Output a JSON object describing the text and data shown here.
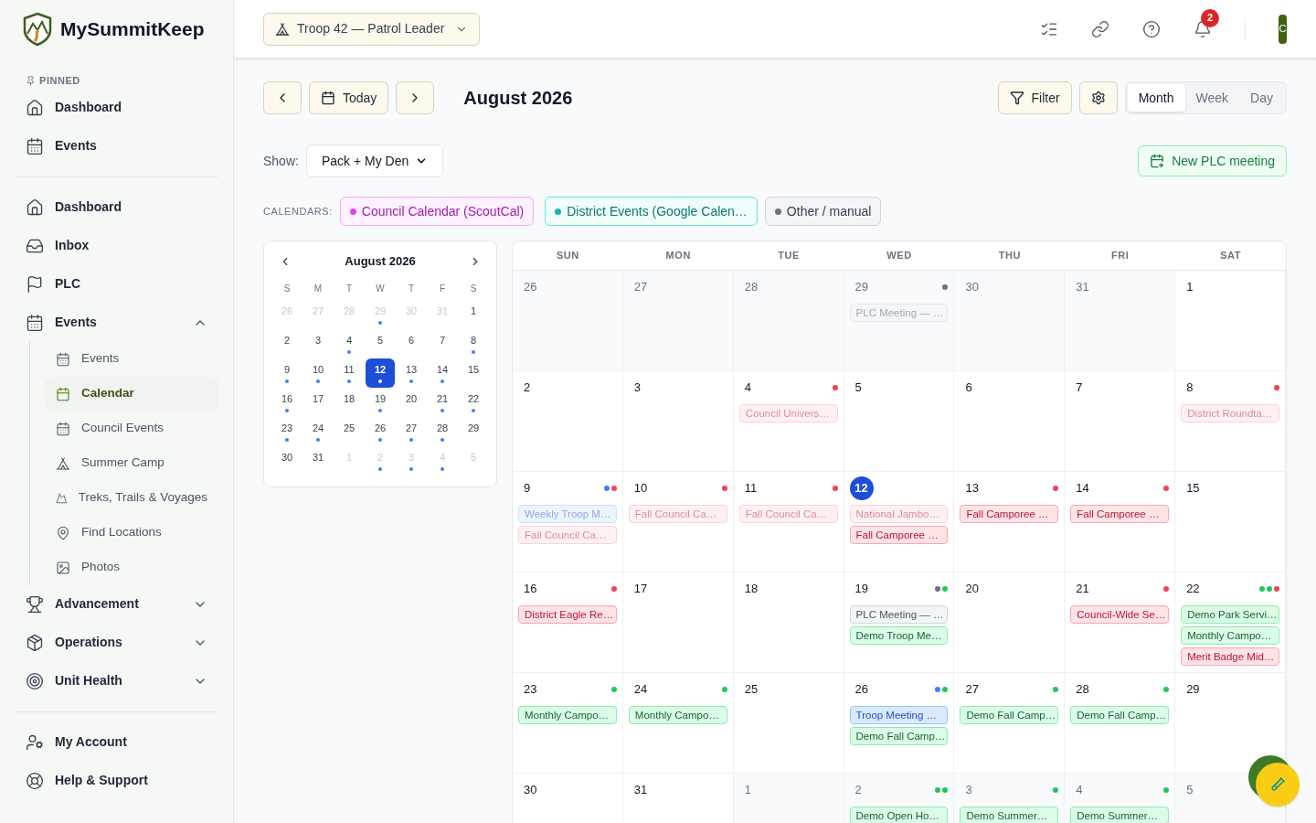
{
  "brand": {
    "name": "MySummitKeep"
  },
  "header": {
    "unit_selector": "Troop 42 — Patrol Leader",
    "notifications": "2",
    "avatar": "C"
  },
  "sidebar": {
    "pinned_label": "PINNED",
    "pinned": [
      {
        "label": "Dashboard",
        "selected": false
      },
      {
        "label": "Events",
        "selected": false
      }
    ],
    "nav": [
      {
        "label": "Dashboard",
        "selected": false
      },
      {
        "label": "Inbox",
        "selected": false
      },
      {
        "label": "PLC",
        "selected": false
      },
      {
        "label": "Events",
        "selected": false,
        "expanded": true,
        "children": [
          {
            "label": "Events",
            "selected": false
          },
          {
            "label": "Calendar",
            "selected": true
          },
          {
            "label": "Council Events",
            "selected": false
          },
          {
            "label": "Summer Camp",
            "selected": false
          },
          {
            "label": "Treks, Trails & Voyages",
            "selected": false
          },
          {
            "label": "Find Locations",
            "selected": false
          },
          {
            "label": "Photos",
            "selected": false
          }
        ]
      },
      {
        "label": "Advancement",
        "selected": false,
        "expanded": false
      },
      {
        "label": "Operations",
        "selected": false,
        "expanded": false
      },
      {
        "label": "Unit Health",
        "selected": false,
        "expanded": false
      }
    ],
    "footer": [
      {
        "label": "My Account",
        "selected": false
      },
      {
        "label": "Help & Support",
        "selected": false
      }
    ]
  },
  "toolbar": {
    "today": "Today",
    "title": "August 2026",
    "filter": "Filter",
    "views": [
      {
        "label": "Month",
        "selected": true
      },
      {
        "label": "Week",
        "selected": false
      },
      {
        "label": "Day",
        "selected": false
      }
    ],
    "show_label": "Show:",
    "show_value": "Pack + My Den",
    "new_button": "New PLC meeting"
  },
  "calendars": {
    "label": "CALENDARS:",
    "items": [
      {
        "label": "Council Calendar (ScoutCal)",
        "color": "#d946ef",
        "kind": "council"
      },
      {
        "label": "District Events (Google Calen…",
        "color": "#14b8a6",
        "kind": "district"
      },
      {
        "label": "Other / manual",
        "color": "#6b7280",
        "kind": "other"
      }
    ]
  },
  "mini_calendar": {
    "title": "August 2026",
    "weekdays": [
      "S",
      "M",
      "T",
      "W",
      "T",
      "F",
      "S"
    ],
    "days": [
      {
        "n": "26",
        "muted": true,
        "dot": false,
        "selected": false
      },
      {
        "n": "27",
        "muted": true,
        "dot": false,
        "selected": false
      },
      {
        "n": "28",
        "muted": true,
        "dot": false,
        "selected": false
      },
      {
        "n": "29",
        "muted": true,
        "dot": true,
        "selected": false
      },
      {
        "n": "30",
        "muted": true,
        "dot": false,
        "selected": false
      },
      {
        "n": "31",
        "muted": true,
        "dot": false,
        "selected": false
      },
      {
        "n": "1",
        "muted": false,
        "dot": false,
        "selected": false
      },
      {
        "n": "2",
        "muted": false,
        "dot": false,
        "selected": false
      },
      {
        "n": "3",
        "muted": false,
        "dot": false,
        "selected": false
      },
      {
        "n": "4",
        "muted": false,
        "dot": true,
        "selected": false
      },
      {
        "n": "5",
        "muted": false,
        "dot": false,
        "selected": false
      },
      {
        "n": "6",
        "muted": false,
        "dot": false,
        "selected": false
      },
      {
        "n": "7",
        "muted": false,
        "dot": false,
        "selected": false
      },
      {
        "n": "8",
        "muted": false,
        "dot": true,
        "selected": false
      },
      {
        "n": "9",
        "muted": false,
        "dot": true,
        "selected": false
      },
      {
        "n": "10",
        "muted": false,
        "dot": true,
        "selected": false
      },
      {
        "n": "11",
        "muted": false,
        "dot": true,
        "selected": false
      },
      {
        "n": "12",
        "muted": false,
        "dot": true,
        "selected": true
      },
      {
        "n": "13",
        "muted": false,
        "dot": true,
        "selected": false
      },
      {
        "n": "14",
        "muted": false,
        "dot": true,
        "selected": false
      },
      {
        "n": "15",
        "muted": false,
        "dot": false,
        "selected": false
      },
      {
        "n": "16",
        "muted": false,
        "dot": true,
        "selected": false
      },
      {
        "n": "17",
        "muted": false,
        "dot": false,
        "selected": false
      },
      {
        "n": "18",
        "muted": false,
        "dot": false,
        "selected": false
      },
      {
        "n": "19",
        "muted": false,
        "dot": true,
        "selected": false
      },
      {
        "n": "20",
        "muted": false,
        "dot": false,
        "selected": false
      },
      {
        "n": "21",
        "muted": false,
        "dot": true,
        "selected": false
      },
      {
        "n": "22",
        "muted": false,
        "dot": true,
        "selected": false
      },
      {
        "n": "23",
        "muted": false,
        "dot": true,
        "selected": false
      },
      {
        "n": "24",
        "muted": false,
        "dot": true,
        "selected": false
      },
      {
        "n": "25",
        "muted": false,
        "dot": false,
        "selected": false
      },
      {
        "n": "26",
        "muted": false,
        "dot": true,
        "selected": false
      },
      {
        "n": "27",
        "muted": false,
        "dot": true,
        "selected": false
      },
      {
        "n": "28",
        "muted": false,
        "dot": true,
        "selected": false
      },
      {
        "n": "29",
        "muted": false,
        "dot": false,
        "selected": false
      },
      {
        "n": "30",
        "muted": false,
        "dot": false,
        "selected": false
      },
      {
        "n": "31",
        "muted": false,
        "dot": false,
        "selected": false
      },
      {
        "n": "1",
        "muted": true,
        "dot": false,
        "selected": false
      },
      {
        "n": "2",
        "muted": true,
        "dot": true,
        "selected": false
      },
      {
        "n": "3",
        "muted": true,
        "dot": true,
        "selected": false
      },
      {
        "n": "4",
        "muted": true,
        "dot": true,
        "selected": false
      },
      {
        "n": "5",
        "muted": true,
        "dot": false,
        "selected": false
      }
    ]
  },
  "month": {
    "weekdays": [
      "SUN",
      "MON",
      "TUE",
      "WED",
      "THU",
      "FRI",
      "SAT"
    ],
    "weeks": [
      [
        {
          "n": "26",
          "muted": true,
          "today": false
        },
        {
          "n": "27",
          "muted": true,
          "today": false
        },
        {
          "n": "28",
          "muted": true,
          "today": false
        },
        {
          "n": "29",
          "muted": true,
          "today": false,
          "dots": [
            {
              "color": "#6b7280"
            }
          ],
          "events": [
            {
              "title": "PLC Meeting — …",
              "kind": "plc",
              "past": true
            }
          ]
        },
        {
          "n": "30",
          "muted": true,
          "today": false
        },
        {
          "n": "31",
          "muted": true,
          "today": false
        },
        {
          "n": "1",
          "muted": false,
          "today": false
        }
      ],
      [
        {
          "n": "2",
          "muted": false,
          "today": false
        },
        {
          "n": "3",
          "muted": false,
          "today": false
        },
        {
          "n": "4",
          "muted": false,
          "today": false,
          "dots": [
            {
              "color": "#f43f5e"
            }
          ],
          "events": [
            {
              "title": "Council Univers…",
              "kind": "council",
              "past": true
            }
          ]
        },
        {
          "n": "5",
          "muted": false,
          "today": false
        },
        {
          "n": "6",
          "muted": false,
          "today": false
        },
        {
          "n": "7",
          "muted": false,
          "today": false
        },
        {
          "n": "8",
          "muted": false,
          "today": false,
          "dots": [
            {
              "color": "#f43f5e"
            }
          ],
          "events": [
            {
              "title": "District Roundta…",
              "kind": "council",
              "past": true
            }
          ]
        }
      ],
      [
        {
          "n": "9",
          "muted": false,
          "today": false,
          "dots": [
            {
              "color": "#3b82f6"
            },
            {
              "color": "#f43f5e"
            }
          ],
          "events": [
            {
              "title": "Weekly Troop M…",
              "kind": "troop",
              "past": true
            },
            {
              "title": "Fall Council Ca…",
              "kind": "council",
              "past": true
            }
          ]
        },
        {
          "n": "10",
          "muted": false,
          "today": false,
          "dots": [
            {
              "color": "#f43f5e"
            }
          ],
          "events": [
            {
              "title": "Fall Council Ca…",
              "kind": "council",
              "past": true
            }
          ]
        },
        {
          "n": "11",
          "muted": false,
          "today": false,
          "dots": [
            {
              "color": "#f43f5e"
            }
          ],
          "events": [
            {
              "title": "Fall Council Ca…",
              "kind": "council",
              "past": true
            }
          ]
        },
        {
          "n": "12",
          "muted": false,
          "today": true,
          "events": [
            {
              "title": "National Jambo…",
              "kind": "council",
              "past": true
            },
            {
              "title": "Fall Camporee …",
              "kind": "council",
              "past": false
            }
          ]
        },
        {
          "n": "13",
          "muted": false,
          "today": false,
          "dots": [
            {
              "color": "#f43f5e"
            }
          ],
          "events": [
            {
              "title": "Fall Camporee …",
              "kind": "council",
              "past": false
            }
          ]
        },
        {
          "n": "14",
          "muted": false,
          "today": false,
          "dots": [
            {
              "color": "#f43f5e"
            }
          ],
          "events": [
            {
              "title": "Fall Camporee …",
              "kind": "council",
              "past": false
            }
          ]
        },
        {
          "n": "15",
          "muted": false,
          "today": false
        }
      ],
      [
        {
          "n": "16",
          "muted": false,
          "today": false,
          "dots": [
            {
              "color": "#f43f5e"
            }
          ],
          "events": [
            {
              "title": "District Eagle Re…",
              "kind": "council",
              "past": false
            }
          ]
        },
        {
          "n": "17",
          "muted": false,
          "today": false
        },
        {
          "n": "18",
          "muted": false,
          "today": false
        },
        {
          "n": "19",
          "muted": false,
          "today": false,
          "dots": [
            {
              "color": "#6b7280"
            },
            {
              "color": "#22c55e"
            }
          ],
          "events": [
            {
              "title": "PLC Meeting — …",
              "kind": "plc",
              "past": false
            },
            {
              "title": "Demo Troop Me…",
              "kind": "unit",
              "past": false
            }
          ]
        },
        {
          "n": "20",
          "muted": false,
          "today": false
        },
        {
          "n": "21",
          "muted": false,
          "today": false,
          "dots": [
            {
              "color": "#f43f5e"
            }
          ],
          "events": [
            {
              "title": "Council-Wide Se…",
              "kind": "council",
              "past": false
            }
          ]
        },
        {
          "n": "22",
          "muted": false,
          "today": false,
          "dots": [
            {
              "color": "#22c55e"
            },
            {
              "color": "#22c55e"
            },
            {
              "color": "#f43f5e"
            }
          ],
          "events": [
            {
              "title": "Demo Park Servi…",
              "kind": "unit",
              "past": false
            },
            {
              "title": "Monthly Campo…",
              "kind": "unit",
              "past": false
            },
            {
              "title": "Merit Badge Mid…",
              "kind": "council",
              "past": false
            }
          ]
        }
      ],
      [
        {
          "n": "23",
          "muted": false,
          "today": false,
          "dots": [
            {
              "color": "#22c55e"
            }
          ],
          "events": [
            {
              "title": "Monthly Campo…",
              "kind": "unit",
              "past": false
            }
          ]
        },
        {
          "n": "24",
          "muted": false,
          "today": false,
          "dots": [
            {
              "color": "#22c55e"
            }
          ],
          "events": [
            {
              "title": "Monthly Campo…",
              "kind": "unit",
              "past": false
            }
          ]
        },
        {
          "n": "25",
          "muted": false,
          "today": false
        },
        {
          "n": "26",
          "muted": false,
          "today": false,
          "dots": [
            {
              "color": "#3b82f6"
            },
            {
              "color": "#22c55e"
            }
          ],
          "events": [
            {
              "title": "Troop Meeting …",
              "kind": "troop",
              "past": false
            },
            {
              "title": "Demo Fall Camp…",
              "kind": "unit",
              "past": false
            }
          ]
        },
        {
          "n": "27",
          "muted": false,
          "today": false,
          "dots": [
            {
              "color": "#22c55e"
            }
          ],
          "events": [
            {
              "title": "Demo Fall Camp…",
              "kind": "unit",
              "past": false
            }
          ]
        },
        {
          "n": "28",
          "muted": false,
          "today": false,
          "dots": [
            {
              "color": "#22c55e"
            }
          ],
          "events": [
            {
              "title": "Demo Fall Camp…",
              "kind": "unit",
              "past": false
            }
          ]
        },
        {
          "n": "29",
          "muted": false,
          "today": false
        }
      ],
      [
        {
          "n": "30",
          "muted": false,
          "today": false
        },
        {
          "n": "31",
          "muted": false,
          "today": false
        },
        {
          "n": "1",
          "muted": true,
          "today": false
        },
        {
          "n": "2",
          "muted": true,
          "today": false,
          "dots": [
            {
              "color": "#22c55e"
            },
            {
              "color": "#22c55e"
            }
          ],
          "events": [
            {
              "title": "Demo Open Ho…",
              "kind": "unit",
              "past": false
            }
          ]
        },
        {
          "n": "3",
          "muted": true,
          "today": false,
          "dots": [
            {
              "color": "#22c55e"
            }
          ],
          "events": [
            {
              "title": "Demo Summer…",
              "kind": "unit",
              "past": false
            }
          ]
        },
        {
          "n": "4",
          "muted": true,
          "today": false,
          "dots": [
            {
              "color": "#22c55e"
            }
          ],
          "events": [
            {
              "title": "Demo Summer…",
              "kind": "unit",
              "past": false
            }
          ]
        },
        {
          "n": "5",
          "muted": true,
          "today": false
        }
      ]
    ]
  }
}
